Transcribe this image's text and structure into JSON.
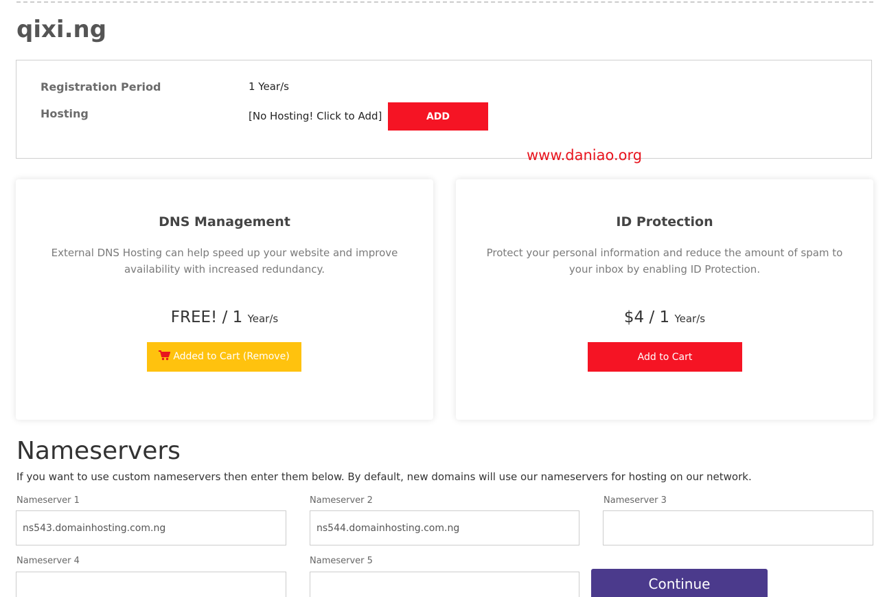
{
  "domain": {
    "title": "qixi.ng"
  },
  "config": {
    "registration_label": "Registration Period",
    "registration_value": "1 Year/s",
    "hosting_label": "Hosting",
    "hosting_value": "[No Hosting! Click to Add]",
    "add_button": "ADD"
  },
  "watermark": "www.daniao.org",
  "addons": [
    {
      "title": "DNS Management",
      "description": "External DNS Hosting can help speed up your website and improve availability with increased redundancy.",
      "price": "FREE! / 1",
      "period": "Year/s",
      "button_label": "Added to Cart (Remove)",
      "button_icon": "shopping-cart-icon",
      "button_color": "#ffc20e"
    },
    {
      "title": "ID Protection",
      "description": "Protect your personal information and reduce the amount of spam to your inbox by enabling ID Protection.",
      "price": "$4 / 1",
      "period": "Year/s",
      "button_label": "Add to Cart",
      "button_color": "#f51424"
    }
  ],
  "nameservers": {
    "heading": "Nameservers",
    "description": "If you want to use custom nameservers then enter them below. By default, new domains will use our nameservers for hosting on our network.",
    "fields": [
      {
        "label": "Nameserver 1",
        "value": "ns543.domainhosting.com.ng"
      },
      {
        "label": "Nameserver 2",
        "value": "ns544.domainhosting.com.ng"
      },
      {
        "label": "Nameserver 3",
        "value": ""
      },
      {
        "label": "Nameserver 4",
        "value": ""
      },
      {
        "label": "Nameserver 5",
        "value": ""
      }
    ],
    "continue_button": "Continue"
  },
  "colors": {
    "accent_red": "#f51424",
    "accent_yellow": "#ffc20e",
    "continue_purple": "#4b3a8c"
  }
}
